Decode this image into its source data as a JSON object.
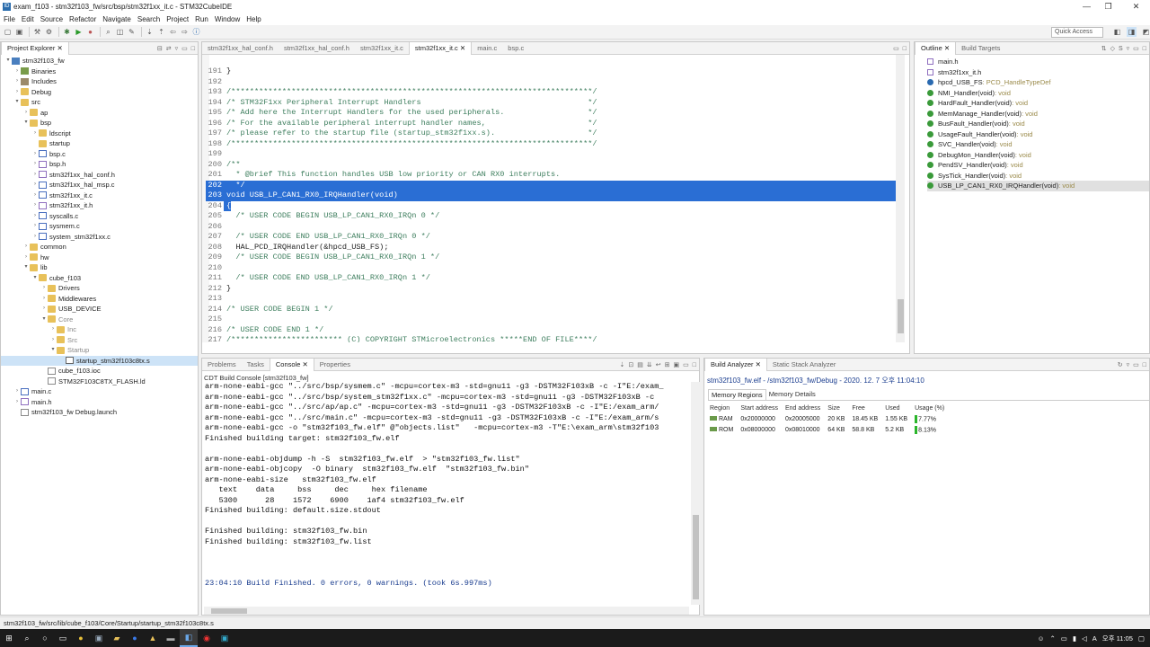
{
  "window": {
    "title": "exam_f103 - stm32f103_fw/src/bsp/stm32f1xx_it.c - STM32CubeIDE"
  },
  "menu": [
    "File",
    "Edit",
    "Source",
    "Refactor",
    "Navigate",
    "Search",
    "Project",
    "Run",
    "Window",
    "Help"
  ],
  "quick_access": "Quick Access",
  "project_explorer": {
    "tab": "Project Explorer",
    "tree": [
      {
        "label": "stm32f103_fw",
        "depth": 0,
        "arrow": "▾",
        "icon": "proj"
      },
      {
        "label": "Binaries",
        "depth": 1,
        "arrow": "›",
        "icon": "bin"
      },
      {
        "label": "Includes",
        "depth": 1,
        "arrow": "›",
        "icon": "inc"
      },
      {
        "label": "Debug",
        "depth": 1,
        "arrow": "›",
        "icon": "folder"
      },
      {
        "label": "src",
        "depth": 1,
        "arrow": "▾",
        "icon": "folder"
      },
      {
        "label": "ap",
        "depth": 2,
        "arrow": "›",
        "icon": "folder"
      },
      {
        "label": "bsp",
        "depth": 2,
        "arrow": "▾",
        "icon": "folder"
      },
      {
        "label": "ldscript",
        "depth": 3,
        "arrow": "›",
        "icon": "folder"
      },
      {
        "label": "startup",
        "depth": 3,
        "arrow": "",
        "icon": "folder"
      },
      {
        "label": "bsp.c",
        "depth": 3,
        "arrow": "›",
        "icon": "cfile"
      },
      {
        "label": "bsp.h",
        "depth": 3,
        "arrow": "›",
        "icon": "hfile"
      },
      {
        "label": "stm32f1xx_hal_conf.h",
        "depth": 3,
        "arrow": "›",
        "icon": "hfile"
      },
      {
        "label": "stm32f1xx_hal_msp.c",
        "depth": 3,
        "arrow": "›",
        "icon": "cfile"
      },
      {
        "label": "stm32f1xx_it.c",
        "depth": 3,
        "arrow": "›",
        "icon": "cfile"
      },
      {
        "label": "stm32f1xx_it.h",
        "depth": 3,
        "arrow": "›",
        "icon": "hfile"
      },
      {
        "label": "syscalls.c",
        "depth": 3,
        "arrow": "›",
        "icon": "cfile"
      },
      {
        "label": "sysmem.c",
        "depth": 3,
        "arrow": "›",
        "icon": "cfile"
      },
      {
        "label": "system_stm32f1xx.c",
        "depth": 3,
        "arrow": "›",
        "icon": "cfile"
      },
      {
        "label": "common",
        "depth": 2,
        "arrow": "›",
        "icon": "folder"
      },
      {
        "label": "hw",
        "depth": 2,
        "arrow": "›",
        "icon": "folder"
      },
      {
        "label": "lib",
        "depth": 2,
        "arrow": "▾",
        "icon": "folder"
      },
      {
        "label": "cube_f103",
        "depth": 3,
        "arrow": "▾",
        "icon": "folder"
      },
      {
        "label": "Drivers",
        "depth": 4,
        "arrow": "›",
        "icon": "folder"
      },
      {
        "label": "Middlewares",
        "depth": 4,
        "arrow": "›",
        "icon": "folder"
      },
      {
        "label": "USB_DEVICE",
        "depth": 4,
        "arrow": "›",
        "icon": "folder"
      },
      {
        "label": "Core",
        "depth": 4,
        "arrow": "▾",
        "icon": "folder",
        "dim": true
      },
      {
        "label": "Inc",
        "depth": 5,
        "arrow": "›",
        "icon": "folder",
        "dim": true
      },
      {
        "label": "Src",
        "depth": 5,
        "arrow": "›",
        "icon": "folder",
        "dim": true
      },
      {
        "label": "Startup",
        "depth": 5,
        "arrow": "▾",
        "icon": "folder",
        "dim": true
      },
      {
        "label": "startup_stm32f103c8tx.s",
        "depth": 6,
        "arrow": "",
        "icon": "sfile",
        "selected": true
      },
      {
        "label": "cube_f103.ioc",
        "depth": 4,
        "arrow": "",
        "icon": "file"
      },
      {
        "label": "STM32F103C8TX_FLASH.ld",
        "depth": 4,
        "arrow": "",
        "icon": "file"
      },
      {
        "label": "main.c",
        "depth": 1,
        "arrow": "›",
        "icon": "cfile"
      },
      {
        "label": "main.h",
        "depth": 1,
        "arrow": "›",
        "icon": "hfile"
      },
      {
        "label": "stm32f103_fw Debug.launch",
        "depth": 1,
        "arrow": "",
        "icon": "file"
      }
    ]
  },
  "editor": {
    "tabs": [
      "stm32f1xx_hal_conf.h",
      "stm32f1xx_hal_conf.h",
      "stm32f1xx_it.c",
      "stm32f1xx_it.c",
      "main.c",
      "bsp.c"
    ],
    "active_tab": 3,
    "lines": [
      {
        "n": "191",
        "t": "}",
        "k": "n"
      },
      {
        "n": "192",
        "t": "",
        "k": "n"
      },
      {
        "n": "193",
        "t": "/******************************************************************************/",
        "k": "c"
      },
      {
        "n": "194",
        "t": "/* STM32F1xx Peripheral Interrupt Handlers                                    */",
        "k": "c"
      },
      {
        "n": "195",
        "t": "/* Add here the Interrupt Handlers for the used peripherals.                  */",
        "k": "c"
      },
      {
        "n": "196",
        "t": "/* For the available peripheral interrupt handler names,                      */",
        "k": "c"
      },
      {
        "n": "197",
        "t": "/* please refer to the startup file (startup_stm32f1xx.s).                    */",
        "k": "c"
      },
      {
        "n": "198",
        "t": "/******************************************************************************/",
        "k": "c"
      },
      {
        "n": "199",
        "t": "",
        "k": "n"
      },
      {
        "n": "200",
        "t": "/**",
        "k": "c"
      },
      {
        "n": "201",
        "t": "  * @brief This function handles USB low priority or CAN RX0 interrupts.",
        "k": "c"
      },
      {
        "n": "202",
        "t": "  */",
        "k": "c",
        "sel": true
      },
      {
        "n": "203",
        "t": "void USB_LP_CAN1_RX0_IRQHandler(void)",
        "k": "n",
        "sel": true
      },
      {
        "n": "204",
        "t": "{",
        "k": "n",
        "selpart": true
      },
      {
        "n": "205",
        "t": "  /* USER CODE BEGIN USB_LP_CAN1_RX0_IRQn 0 */",
        "k": "c"
      },
      {
        "n": "206",
        "t": "",
        "k": "n"
      },
      {
        "n": "207",
        "t": "  /* USER CODE END USB_LP_CAN1_RX0_IRQn 0 */",
        "k": "c"
      },
      {
        "n": "208",
        "t": "  HAL_PCD_IRQHandler(&hpcd_USB_FS);",
        "k": "n"
      },
      {
        "n": "209",
        "t": "  /* USER CODE BEGIN USB_LP_CAN1_RX0_IRQn 1 */",
        "k": "c"
      },
      {
        "n": "210",
        "t": "",
        "k": "n"
      },
      {
        "n": "211",
        "t": "  /* USER CODE END USB_LP_CAN1_RX0_IRQn 1 */",
        "k": "c"
      },
      {
        "n": "212",
        "t": "}",
        "k": "n"
      },
      {
        "n": "213",
        "t": "",
        "k": "n"
      },
      {
        "n": "214",
        "t": "/* USER CODE BEGIN 1 */",
        "k": "c"
      },
      {
        "n": "215",
        "t": "",
        "k": "n"
      },
      {
        "n": "216",
        "t": "/* USER CODE END 1 */",
        "k": "c"
      },
      {
        "n": "217",
        "t": "/************************ (C) COPYRIGHT STMicroelectronics *****END OF FILE****/",
        "k": "c"
      },
      {
        "n": "218",
        "t": "",
        "k": "n"
      }
    ]
  },
  "outline": {
    "tabs": [
      "Outline",
      "Build Targets"
    ],
    "items": [
      {
        "name": "main.h",
        "type": "",
        "icon": "h"
      },
      {
        "name": "stm32f1xx_it.h",
        "type": "",
        "icon": "h"
      },
      {
        "name": "hpcd_USB_FS",
        "type": " : PCD_HandleTypeDef",
        "icon": "blue"
      },
      {
        "name": "NMI_Handler(void)",
        "type": " : void",
        "icon": "green"
      },
      {
        "name": "HardFault_Handler(void)",
        "type": " : void",
        "icon": "green"
      },
      {
        "name": "MemManage_Handler(void)",
        "type": " : void",
        "icon": "green"
      },
      {
        "name": "BusFault_Handler(void)",
        "type": " : void",
        "icon": "green"
      },
      {
        "name": "UsageFault_Handler(void)",
        "type": " : void",
        "icon": "green"
      },
      {
        "name": "SVC_Handler(void)",
        "type": " : void",
        "icon": "green"
      },
      {
        "name": "DebugMon_Handler(void)",
        "type": " : void",
        "icon": "green"
      },
      {
        "name": "PendSV_Handler(void)",
        "type": " : void",
        "icon": "green"
      },
      {
        "name": "SysTick_Handler(void)",
        "type": " : void",
        "icon": "green"
      },
      {
        "name": "USB_LP_CAN1_RX0_IRQHandler(void)",
        "type": " : void",
        "icon": "green",
        "selected": true
      }
    ]
  },
  "console": {
    "tabs": [
      "Problems",
      "Tasks",
      "Console",
      "Properties"
    ],
    "header": "CDT Build Console [stm32f103_fw]",
    "lines": [
      {
        "t": "arm-none-eabi-gcc \"../src/bsp/sysmem.c\" -mcpu=cortex-m3 -std=gnu11 -g3 -DSTM32F103xB -c -I\"E:/exam_"
      },
      {
        "t": "arm-none-eabi-gcc \"../src/bsp/system_stm32f1xx.c\" -mcpu=cortex-m3 -std=gnu11 -g3 -DSTM32F103xB -c"
      },
      {
        "t": "arm-none-eabi-gcc \"../src/ap/ap.c\" -mcpu=cortex-m3 -std=gnu11 -g3 -DSTM32F103xB -c -I\"E:/exam_arm/"
      },
      {
        "t": "arm-none-eabi-gcc \"../src/main.c\" -mcpu=cortex-m3 -std=gnu11 -g3 -DSTM32F103xB -c -I\"E:/exam_arm/s"
      },
      {
        "t": "arm-none-eabi-gcc -o \"stm32f103_fw.elf\" @\"objects.list\"   -mcpu=cortex-m3 -T\"E:\\exam_arm\\stm32f103"
      },
      {
        "t": "Finished building target: stm32f103_fw.elf"
      },
      {
        "t": " "
      },
      {
        "t": "arm-none-eabi-objdump -h -S  stm32f103_fw.elf  > \"stm32f103_fw.list\""
      },
      {
        "t": "arm-none-eabi-objcopy  -O binary  stm32f103_fw.elf  \"stm32f103_fw.bin\""
      },
      {
        "t": "arm-none-eabi-size   stm32f103_fw.elf"
      },
      {
        "t": "   text    data     bss     dec     hex filename"
      },
      {
        "t": "   5300      28    1572    6900    1af4 stm32f103_fw.elf"
      },
      {
        "t": "Finished building: default.size.stdout"
      },
      {
        "t": " "
      },
      {
        "t": "Finished building: stm32f103_fw.bin"
      },
      {
        "t": "Finished building: stm32f103_fw.list"
      },
      {
        "t": " "
      },
      {
        "t": " "
      },
      {
        "t": " "
      },
      {
        "t": "23:04:10 Build Finished. 0 errors, 0 warnings. (took 6s.997ms)",
        "finish": true
      }
    ]
  },
  "build_analyzer": {
    "tabs": [
      "Build Analyzer",
      "Static Stack Analyzer"
    ],
    "title": "stm32f103_fw.elf - /stm32f103_fw/Debug - 2020. 12. 7 오후 11:04:10",
    "subtabs": [
      "Memory Regions",
      "Memory Details"
    ],
    "columns": [
      "Region",
      "Start address",
      "End address",
      "Size",
      "Free",
      "Used",
      "Usage (%)"
    ],
    "rows": [
      {
        "region": "RAM",
        "start": "0x20000000",
        "end": "0x20005000",
        "size": "20 KB",
        "free": "18.45 KB",
        "used": "1.55 KB",
        "usage": "7.77%"
      },
      {
        "region": "ROM",
        "start": "0x08000000",
        "end": "0x08010000",
        "size": "64 KB",
        "free": "58.8 KB",
        "used": "5.2 KB",
        "usage": "8.13%"
      }
    ]
  },
  "status": {
    "path": "stm32f103_fw/src/lib/cube_f103/Core/Startup/startup_stm32f103c8tx.s"
  },
  "taskbar": {
    "ime": "A",
    "time": "오후 11:05"
  }
}
